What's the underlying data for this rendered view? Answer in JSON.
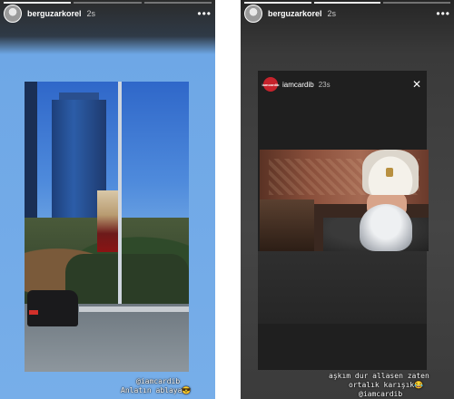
{
  "left_story": {
    "username": "berguzarkorel",
    "time": "2s",
    "progress_segments": [
      true,
      false,
      false
    ],
    "mention": "@iamcardib",
    "caption": "Anlatın ablaya😎"
  },
  "right_story": {
    "username": "berguzarkorel",
    "time": "2s",
    "progress_segments": [
      true,
      true,
      false
    ],
    "repost": {
      "username": "iamcardib",
      "time": "23s",
      "avatar_text": "iamcardib"
    },
    "caption_line1": "aşkım dur allasen zaten",
    "caption_line2": "ortalık karışık😂",
    "mention": "@iamcardib"
  },
  "colors": {
    "sky": "#77aee9",
    "dark_bg": "#3b3b3b"
  },
  "icons": [
    "more-icon",
    "close-icon",
    "avatar"
  ]
}
